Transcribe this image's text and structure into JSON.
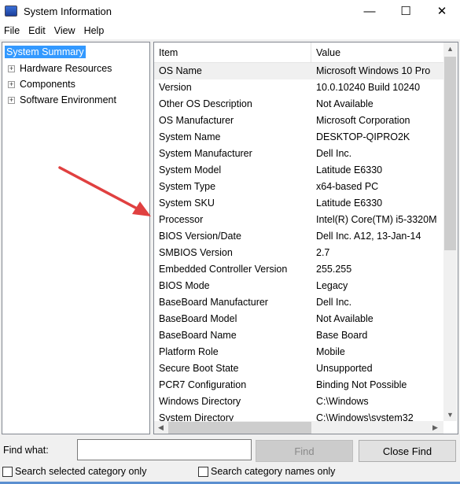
{
  "window": {
    "title": "System Information",
    "minimize": "—",
    "maximize": "☐",
    "close": "✕"
  },
  "menu": [
    "File",
    "Edit",
    "View",
    "Help"
  ],
  "tree": {
    "selected": "System Summary",
    "items": [
      "Hardware Resources",
      "Components",
      "Software Environment"
    ]
  },
  "table": {
    "headers": [
      "Item",
      "Value"
    ],
    "rows": [
      [
        "OS Name",
        "Microsoft Windows 10 Pro"
      ],
      [
        "Version",
        "10.0.10240 Build 10240"
      ],
      [
        "Other OS Description",
        "Not Available"
      ],
      [
        "OS Manufacturer",
        "Microsoft Corporation"
      ],
      [
        "System Name",
        "DESKTOP-QIPRO2K"
      ],
      [
        "System Manufacturer",
        "Dell Inc."
      ],
      [
        "System Model",
        "Latitude E6330"
      ],
      [
        "System Type",
        "x64-based PC"
      ],
      [
        "System SKU",
        "Latitude E6330"
      ],
      [
        "Processor",
        "Intel(R) Core(TM) i5-3320M"
      ],
      [
        "BIOS Version/Date",
        "Dell Inc. A12, 13-Jan-14"
      ],
      [
        "SMBIOS Version",
        "2.7"
      ],
      [
        "Embedded Controller Version",
        "255.255"
      ],
      [
        "BIOS Mode",
        "Legacy"
      ],
      [
        "BaseBoard Manufacturer",
        "Dell Inc."
      ],
      [
        "BaseBoard Model",
        "Not Available"
      ],
      [
        "BaseBoard Name",
        "Base Board"
      ],
      [
        "Platform Role",
        "Mobile"
      ],
      [
        "Secure Boot State",
        "Unsupported"
      ],
      [
        "PCR7 Configuration",
        "Binding Not Possible"
      ],
      [
        "Windows Directory",
        "C:\\Windows"
      ],
      [
        "System Directory",
        "C:\\Windows\\system32"
      ]
    ]
  },
  "find": {
    "label": "Find what:",
    "value": "",
    "find_button": "Find",
    "close_button": "Close Find",
    "check1": "Search selected category only",
    "check2": "Search category names only"
  },
  "colors": {
    "selection": "#3399ff",
    "annotation_arrow": "#e04040"
  }
}
